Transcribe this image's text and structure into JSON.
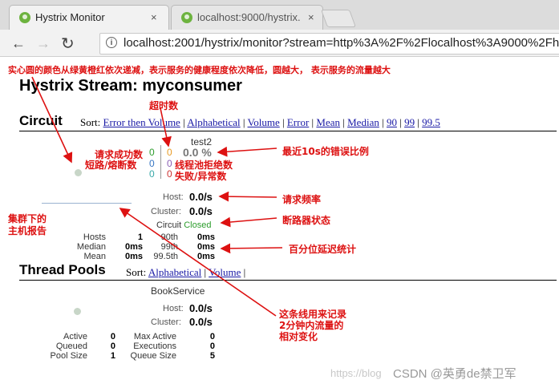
{
  "browser": {
    "tabs": [
      {
        "title": "Hystrix Monitor",
        "close": "×"
      },
      {
        "title": "localhost:9000/hystrix.",
        "close": "×"
      }
    ],
    "url": "localhost:2001/hystrix/monitor?stream=http%3A%2F%2Flocalhost%3A9000%2Fh"
  },
  "annotations": {
    "top": "实心圆的颜色从绿黄橙红依次递减，表示服务的健康程度依次降低，圆越大，  表示服务的流量越大",
    "timeout": "超时数",
    "success": "请求成功数",
    "short": "短路/熔断数",
    "error_pct": "最近10s的错误比例",
    "threadpool_reject": "线程池拒绝数",
    "failure": "失败/异常数",
    "rate": "请求频率",
    "cluster_report_1": "集群下的",
    "cluster_report_2": "主机报告",
    "breaker": "断路器状态",
    "percentile": "百分位延迟统计",
    "line_1": "这条线用来记录",
    "line_2": "2分钟内流量的",
    "line_3": "相对变化"
  },
  "page": {
    "title": "Hystrix Stream: myconsumer",
    "circuit_heading": "Circuit",
    "threadpool_heading": "Thread Pools",
    "sort_label": "Sort:"
  },
  "circuit_sort": [
    "Error then Volume",
    "Alphabetical",
    "Volume",
    "Error",
    "Mean",
    "Median",
    "90",
    "99",
    "99.5"
  ],
  "threadpool_sort": [
    "Alphabetical",
    "Volume"
  ],
  "separator": "|",
  "circuit": {
    "name": "test2",
    "success": "0",
    "short_circuited": "0",
    "bad_request": "0",
    "timeout": "0",
    "rejected": "0",
    "failure": "0",
    "error_pct": "0.0 %",
    "host_label": "Host:",
    "host_rate": "0.0/s",
    "cluster_label": "Cluster:",
    "cluster_rate": "0.0/s",
    "circuit_label": "Circuit",
    "circuit_status": "Closed",
    "stats": [
      [
        "Hosts",
        "1",
        "90th",
        "0ms"
      ],
      [
        "Median",
        "0ms",
        "99th",
        "0ms"
      ],
      [
        "Mean",
        "0ms",
        "99.5th",
        "0ms"
      ]
    ]
  },
  "threadpool": {
    "name": "BookService",
    "host_label": "Host:",
    "host_rate": "0.0/s",
    "cluster_label": "Cluster:",
    "cluster_rate": "0.0/s",
    "stats": [
      [
        "Active",
        "0",
        "Max Active",
        "0"
      ],
      [
        "Queued",
        "0",
        "Executions",
        "0"
      ],
      [
        "Pool Size",
        "1",
        "Queue Size",
        "5"
      ]
    ]
  },
  "watermark": {
    "url": "https://blog",
    "brand": "CSDN @英勇de禁卫军"
  },
  "colors": {
    "annotation": "#dd1111",
    "success": "#2c9c2c",
    "timeout": "#e89b26",
    "rejected": "#8a5fb5",
    "bad_request": "#39a8a8",
    "failure": "#cc3333",
    "health_circle": "#c8d6c8",
    "link": "#1a1aa6"
  }
}
